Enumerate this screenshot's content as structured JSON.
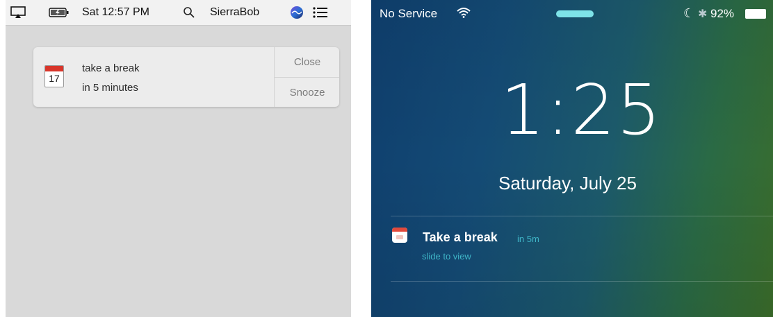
{
  "mac": {
    "menubar": {
      "clock": "Sat 12:57 PM",
      "user": "SierraBob",
      "icons": [
        "airplay-icon",
        "battery-icon",
        "search-icon",
        "siri-icon",
        "notification-center-icon"
      ]
    },
    "notification": {
      "app_icon": "calendar-icon",
      "calendar_day": "17",
      "title": "take a break",
      "subtitle": "in 5 minutes",
      "close_label": "Close",
      "snooze_label": "Snooze"
    }
  },
  "ios": {
    "status": {
      "carrier": "No Service",
      "battery_percent": "92%"
    },
    "time": "1:25",
    "date": "Saturday, July 25",
    "notification": {
      "app_icon": "calendar-icon",
      "title": "Take a break",
      "when": "in 5m",
      "hint": "slide to view"
    }
  },
  "colors": {
    "mac_background": "#d9d9d9",
    "menubar": "#f2f2f2",
    "calendar_red": "#d8352a",
    "ios_accent": "#3fb6c8",
    "grabber": "#7ee3e8"
  }
}
